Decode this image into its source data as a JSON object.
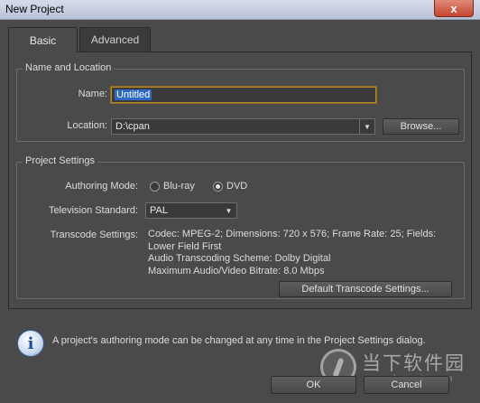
{
  "window": {
    "title": "New Project",
    "close_glyph": "x"
  },
  "tabs": [
    {
      "label": "Basic"
    },
    {
      "label": "Advanced"
    }
  ],
  "name_location": {
    "legend": "Name and Location",
    "name_label": "Name:",
    "name_value": "Untitled",
    "location_label": "Location:",
    "location_value": "D:\\cpan",
    "browse_label": "Browse..."
  },
  "project_settings": {
    "legend": "Project Settings",
    "authoring_label": "Authoring Mode:",
    "authoring_options": [
      {
        "label": "Blu-ray",
        "selected": false
      },
      {
        "label": "DVD",
        "selected": true
      }
    ],
    "tv_label": "Television Standard:",
    "tv_value": "PAL",
    "transcode_label": "Transcode Settings:",
    "transcode_lines": [
      "Codec: MPEG-2; Dimensions: 720 x 576; Frame Rate: 25; Fields:",
      "Lower Field First",
      "Audio Transcoding Scheme: Dolby Digital",
      "Maximum Audio/Video Bitrate: 8.0 Mbps"
    ],
    "default_transcode_label": "Default Transcode Settings..."
  },
  "info_message": "A project's authoring mode can be changed at any time in the Project Settings dialog.",
  "buttons": {
    "ok": "OK",
    "cancel": "Cancel"
  },
  "watermark": {
    "cn": "当下软件园",
    "url": "www.downxia.com"
  },
  "icons": {
    "info": "info-icon",
    "close": "close-icon",
    "dropdown": "chevron-down-icon"
  }
}
